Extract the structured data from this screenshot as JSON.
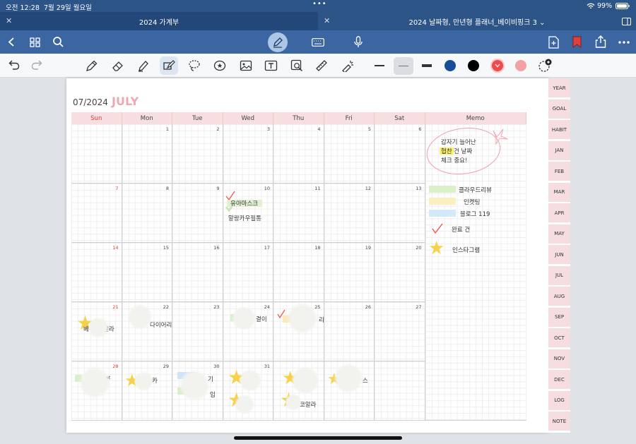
{
  "status": {
    "time": "오전 12:28",
    "date": "7월 29일 월요일",
    "battery": "99%"
  },
  "tabs": [
    {
      "title": "2024 가계부"
    },
    {
      "title": "2024 날짜형, 만년형 플래너_베이비핑크 3 ⌄"
    }
  ],
  "planner": {
    "year_month": "07/2024",
    "month_name": "JULY",
    "headers": [
      "Sun",
      "Mon",
      "Tue",
      "Wed",
      "Thu",
      "Fri",
      "Sat",
      "Memo"
    ],
    "weeks": [
      [
        "",
        "1",
        "2",
        "3",
        "4",
        "5",
        "6"
      ],
      [
        "7",
        "8",
        "9",
        "10",
        "11",
        "12",
        "13"
      ],
      [
        "14",
        "15",
        "16",
        "17",
        "18",
        "19",
        "20"
      ],
      [
        "21",
        "22",
        "23",
        "24",
        "25",
        "26",
        "27"
      ],
      [
        "28",
        "29",
        "30",
        "31",
        "",
        "",
        ""
      ]
    ],
    "cell_notes": {
      "w2_wed_1": "유아마스크",
      "w2_wed_2": "말랑카우필통",
      "w4_sun": "베",
      "w4_sun_b": "알라",
      "w4_mon": "다이어리",
      "w4_wed": "결이",
      "w4_thu": "리",
      "w5_sun": "set",
      "w5_mon": "카",
      "w5_tue_1": "기",
      "w5_tue_2": "임",
      "w5_fri": "스",
      "w5_thu_2": "코알라"
    },
    "memo": {
      "note_line1": "갑자기 늘어난",
      "note_hl": "협찬",
      "note_line2_rest": " 건 날짜",
      "note_line3": "체크 중요!",
      "legend": [
        "클라우드리뷰",
        "인켓팅",
        "블로그 119",
        "완료 건",
        "인스타그램"
      ]
    },
    "side_tabs": [
      "YEAR",
      "GOAL",
      "HABIT",
      "JAN",
      "FEB",
      "MAR",
      "APR",
      "MAY",
      "JUN",
      "JUL",
      "AUG",
      "SEP",
      "OCT",
      "NOV",
      "DEC",
      "LOG",
      "NOTE"
    ]
  },
  "colors": {
    "accent": "#3b66a1",
    "pink": "#f0a7b4",
    "pen_red": "#ef4b4b",
    "pen_pink": "#f4a1a6",
    "pen_blue": "#164e9c"
  }
}
